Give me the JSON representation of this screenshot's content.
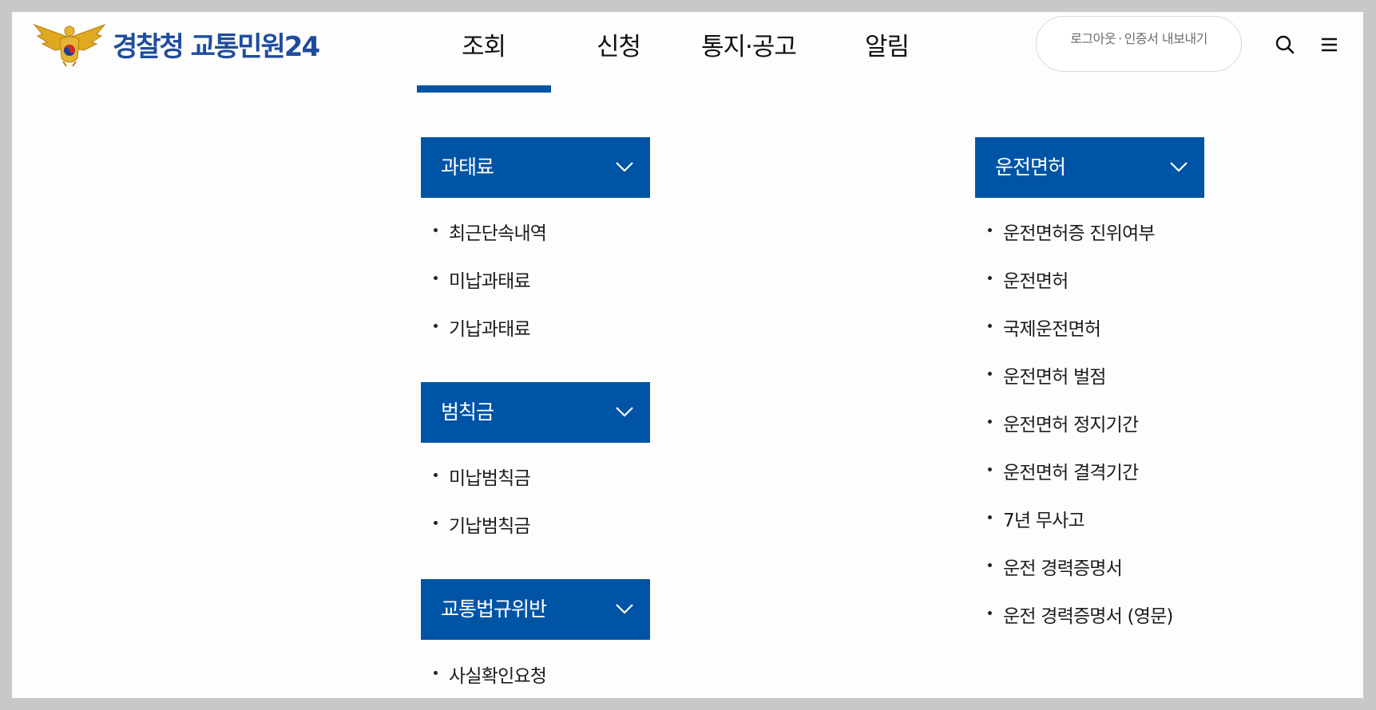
{
  "header": {
    "logo_text": "경찰청 교통민원24",
    "nav": [
      {
        "label": "조회"
      },
      {
        "label": "신청"
      },
      {
        "label": "통지·공고"
      },
      {
        "label": "알림"
      }
    ],
    "auth": {
      "logout": "로그아웃",
      "separator": "·",
      "export_cert": "인증서 내보내기"
    },
    "accent_color": "#0054a6"
  },
  "menu": {
    "fine": {
      "title": "과태료",
      "items": [
        "최근단속내역",
        "미납과태료",
        "기납과태료"
      ]
    },
    "penalty": {
      "title": "범칙금",
      "items": [
        "미납범칙금",
        "기납범칙금"
      ]
    },
    "violation": {
      "title": "교통법규위반",
      "items": [
        "사실확인요청"
      ]
    },
    "license": {
      "title": "운전면허",
      "items": [
        "운전면허증 진위여부",
        "운전면허",
        "국제운전면허",
        "운전면허 벌점",
        "운전면허 정지기간",
        "운전면허 결격기간",
        "7년 무사고",
        "운전 경력증명서",
        "운전 경력증명서 (영문)"
      ]
    }
  }
}
